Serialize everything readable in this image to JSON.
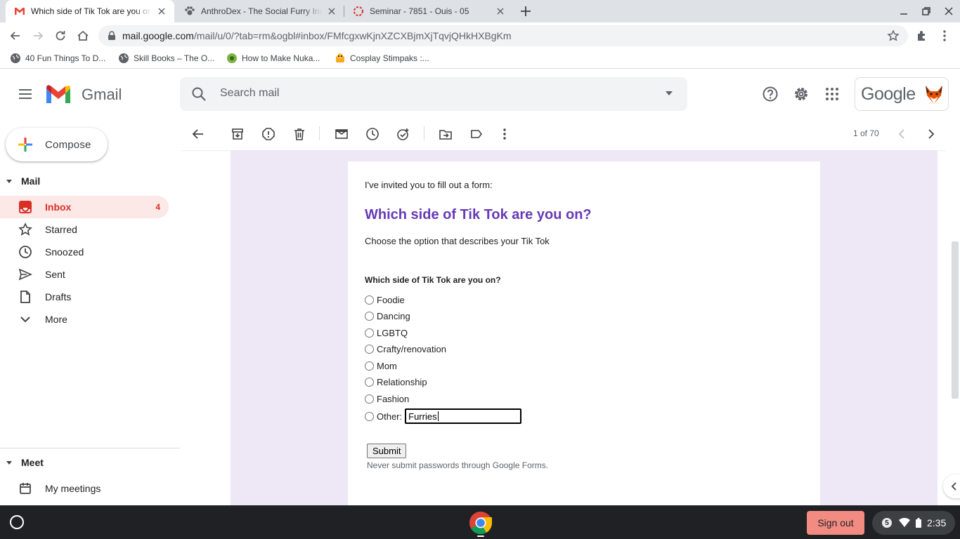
{
  "browser": {
    "tabs": [
      {
        "title": "Which side of Tik Tok are you on?",
        "active": true
      },
      {
        "title": "AnthroDex - The Social Furry Index"
      },
      {
        "title": "Seminar - 7851 - Ouis - 05"
      }
    ],
    "url_host": "mail.google.com",
    "url_path": "/mail/u/0/?tab=rm&ogbl#inbox/FMfcgxwKjnXZCXBjmXjTqvjQHkHXBgKm",
    "bookmarks": [
      {
        "label": "40 Fun Things To D..."
      },
      {
        "label": "Skill Books – The O..."
      },
      {
        "label": "How to Make Nuka..."
      },
      {
        "label": "Cosplay Stimpaks :..."
      }
    ]
  },
  "gmail": {
    "logo_text": "Gmail",
    "search_placeholder": "Search mail",
    "google_word": "Google",
    "compose_label": "Compose",
    "mail_section": "Mail",
    "nav": [
      {
        "label": "Inbox",
        "count": "4",
        "icon": "inbox-icon"
      },
      {
        "label": "Starred",
        "icon": "star-icon"
      },
      {
        "label": "Snoozed",
        "icon": "clock-icon"
      },
      {
        "label": "Sent",
        "icon": "send-icon"
      },
      {
        "label": "Drafts",
        "icon": "draft-icon"
      },
      {
        "label": "More",
        "icon": "chevron-down-icon"
      }
    ],
    "meet_section": "Meet",
    "meet_item": "My meetings",
    "pager": "1 of 70"
  },
  "email": {
    "invite_text": "I've invited you to fill out a form:",
    "form_title": "Which side of Tik Tok are you on?",
    "form_description": "Choose the option that describes your Tik Tok",
    "question": "Which side of Tik Tok are you on?",
    "options": [
      "Foodie",
      "Dancing",
      "LGBTQ",
      "Crafty/renovation",
      "Mom",
      "Relationship",
      "Fashion"
    ],
    "other_label": "Other:",
    "other_value": "Furries",
    "submit_label": "Submit",
    "warning": "Never submit passwords through Google Forms."
  },
  "shelf": {
    "signout_label": "Sign out",
    "notification_count": "5",
    "time": "2:35"
  },
  "colors": {
    "form_accent": "#673ab7",
    "form_background": "#ede7f6",
    "inbox_active_bg": "#fce8e6",
    "inbox_active_text": "#d93025",
    "signout_bg": "#f28b82"
  }
}
